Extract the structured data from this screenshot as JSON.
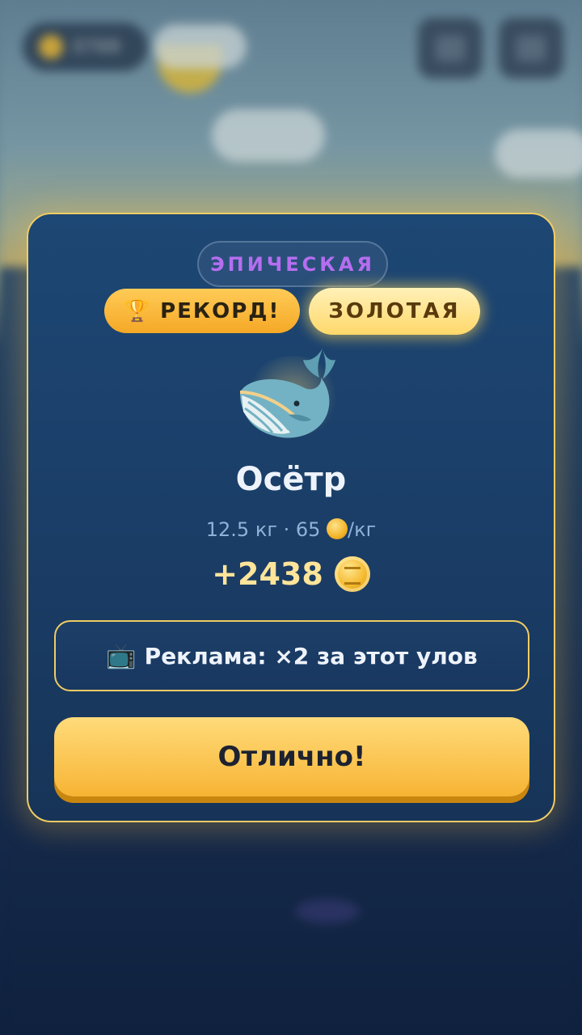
{
  "background": {
    "coin_balance": "3788"
  },
  "modal": {
    "rarity_label": "ЭПИЧЕСКАЯ",
    "record_badge": {
      "icon": "🏆",
      "label": "РЕКОРД!"
    },
    "quality_badge": "ЗОЛОТАЯ",
    "fish_icon": "🐋",
    "fish_name": "Осётр",
    "stats": {
      "weight": "12.5 кг",
      "separator": "·",
      "price": "65",
      "unit": "/кг"
    },
    "reward": "+2438",
    "ad_button": {
      "icon": "📺",
      "label": "Реклама: ×2 за этот улов"
    },
    "ok_button": "Отлично!"
  },
  "colors": {
    "accent_gold": "#f1cc63",
    "rarity_epic": "#b56ef0",
    "modal_bg": "#1d4774"
  }
}
